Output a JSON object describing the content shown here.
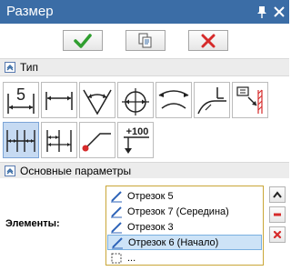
{
  "window": {
    "title": "Размер"
  },
  "sections": {
    "type": "Тип",
    "main_params": "Основные параметры"
  },
  "type_buttons": [
    {
      "name": "linear-dimension",
      "label": "5"
    },
    {
      "name": "dimension-line"
    },
    {
      "name": "angular-dimension"
    },
    {
      "name": "radial-dimension"
    },
    {
      "name": "arc-length-dimension"
    },
    {
      "name": "leader-dimension"
    },
    {
      "name": "hatch-dimension"
    },
    {
      "name": "chain-dimension",
      "selected": true
    },
    {
      "name": "baseline-dimension"
    },
    {
      "name": "point-dimension"
    },
    {
      "name": "level-dimension",
      "label": "+100"
    }
  ],
  "elements": {
    "label": "Элементы:",
    "items": [
      {
        "text": "Отрезок 5",
        "icon": "segment-icon"
      },
      {
        "text": "Отрезок 7 (Середина)",
        "icon": "segment-icon"
      },
      {
        "text": "Отрезок 3",
        "icon": "segment-icon"
      },
      {
        "text": "Отрезок 6 (Начало)",
        "icon": "segment-icon",
        "selected": true
      },
      {
        "text": "...",
        "icon": "empty-box-icon"
      }
    ]
  },
  "colors": {
    "title_bar": "#3b6da6",
    "ok_check": "#2f9e2f",
    "cancel_cross": "#d62b2b",
    "selection": "#c6daf2",
    "list_border": "#c9a637"
  }
}
